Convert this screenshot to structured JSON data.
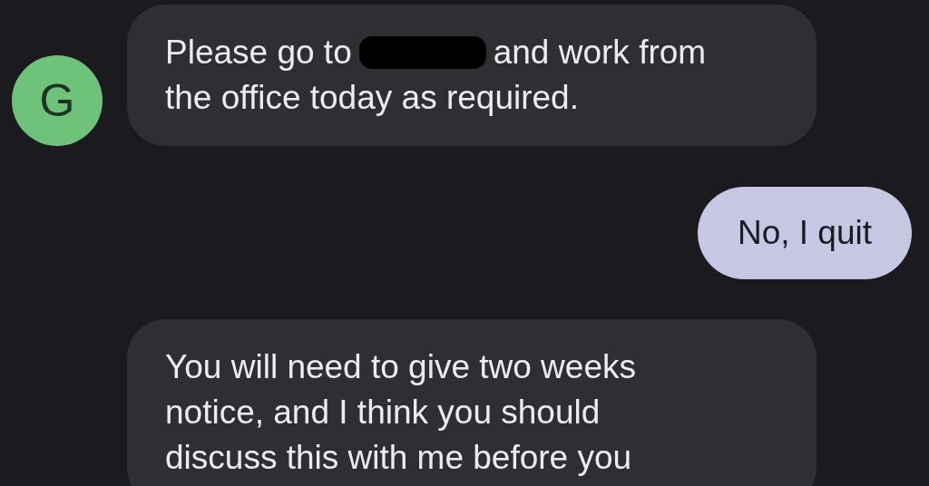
{
  "messages": [
    {
      "kind": "incoming",
      "avatar": "G",
      "lines": [
        [
          {
            "kind": "text",
            "text": "Please go to"
          },
          {
            "kind": "redaction"
          },
          {
            "kind": "text",
            "text": "and work from"
          }
        ],
        [
          {
            "kind": "text",
            "text": "the office today as required."
          }
        ]
      ]
    },
    {
      "kind": "outgoing",
      "lines": [
        [
          {
            "kind": "text",
            "text": "No, I quit"
          }
        ]
      ]
    },
    {
      "kind": "incoming",
      "lines": [
        [
          {
            "kind": "text",
            "text": "You will need to give two weeks"
          }
        ],
        [
          {
            "kind": "text",
            "text": "notice, and I think you should"
          }
        ],
        [
          {
            "kind": "text",
            "text": "discuss this with me before you"
          }
        ]
      ]
    }
  ]
}
